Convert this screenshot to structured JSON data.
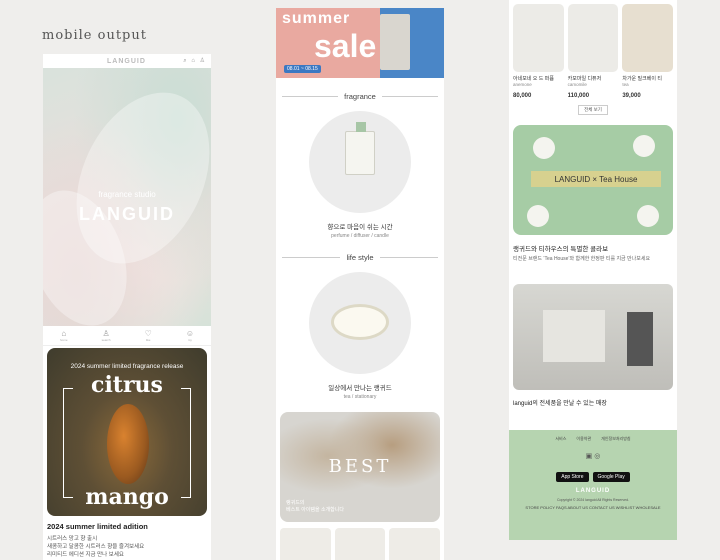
{
  "heading": "mobile output",
  "col1": {
    "logo": "LANGUID",
    "top_icons": [
      "⌕",
      "⌂",
      "♙"
    ],
    "hero_sub": "fragrance studio",
    "hero_logo": "LANGUID",
    "tabs": [
      {
        "icon": "⌂",
        "label": "home"
      },
      {
        "icon": "♙",
        "label": "search"
      },
      {
        "icon": "♡",
        "label": "like"
      },
      {
        "icon": "☺",
        "label": "my"
      }
    ],
    "promo_sub": "2024 summer limited fragrance release",
    "promo_t1": "citrus",
    "promo_t2": "mango",
    "title": "2024 summer limited adition",
    "desc1": "시트러스 망고 향 출시",
    "desc2": "새콤하고 달콤한 시트러스 향을 즐겨보세요",
    "desc3": "리미티드 에디션 지금 만나 보세요"
  },
  "col2": {
    "sale_s": "summer",
    "sale_b": "sale",
    "sale_date": "08.01 ~ 08.15",
    "sec1": "fragrance",
    "sec1_cap1": "향으로 마음이 쉬는 시간",
    "sec1_cap2": "perfume / diffuser / candle",
    "sec2": "life style",
    "sec2_cap1": "일상에서 만나는 랭귀드",
    "sec2_cap2": "tea / stationary",
    "best": "BEST",
    "best_d1": "랭귀드의",
    "best_d2": "베스트 아이템을 소개합니다"
  },
  "col3": {
    "products": [
      {
        "name": "아네모네 오 드 퍼퓸",
        "en": "anemone",
        "price": "80,000"
      },
      {
        "name": "카모마일 디퓨저",
        "en": "camomile",
        "price": "110,000"
      },
      {
        "name": "차가운 밀크베이 티",
        "en": "tea",
        "price": "39,000"
      }
    ],
    "more": "전체 보기",
    "tea_badge": "LANGUID × Tea House",
    "tea_title": "랭귀드와 티하우스의 특별한 콜라보",
    "tea_desc": "티전문 브랜드 ‘Tea House’와 함께한 한정판 티를 지금 만나보세요",
    "store_title": "languid의 전세품을 만날 수 있는 매장",
    "foot_links": [
      "서비스",
      "이용약관",
      "개인정보처리방침"
    ],
    "app_store": "App Store",
    "google_play": "Google Play",
    "foot_logo": "LANGUID",
    "copyright": "Copyright © 2024 languid  All Rights Reserved.",
    "foot_links2": "STORE POLICY   FAQS   ABOUT US   CONTACT US   WISHLIST   WHOLESALE"
  }
}
